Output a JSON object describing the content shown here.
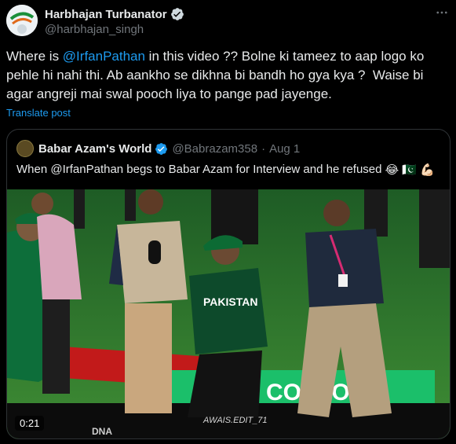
{
  "tweet": {
    "display_name": "Harbhajan Turbanator",
    "handle": "@harbhajan_singh",
    "text_parts": [
      {
        "t": "Where is ",
        "mention": false
      },
      {
        "t": "@IrfanPathan",
        "mention": true
      },
      {
        "t": " in this video ?? Bolne ki tameez to aap logo ko pehle hi nahi thi. Ab aankho se dikhna bi bandh ho gya kya ?  Waise bi agar angreji mai swal pooch liya to pange pad jayenge.",
        "mention": false
      }
    ],
    "translate_label": "Translate post"
  },
  "quote": {
    "display_name": "Babar Azam's World",
    "handle": "@Babrazam358",
    "separator": "·",
    "date": "Aug 1",
    "text": "When @IrfanPathan begs to Babar Azam for Interview and he refused",
    "emojis": [
      "😂",
      "🇵🇰",
      "💪🏻"
    ]
  },
  "media": {
    "jersey_text": "PAKISTAN",
    "duration": "0:21",
    "watermark": "AWAIS.EDIT_71",
    "board_text": "CO  ICO",
    "corner_text": "DNA"
  },
  "colors": {
    "accent": "#1d9bf0",
    "text": "#e7e9ea",
    "muted": "#71767b",
    "border": "#2f3336"
  },
  "icons": {
    "more": "more-horizontal-icon",
    "verified": "verified-badge-icon"
  }
}
